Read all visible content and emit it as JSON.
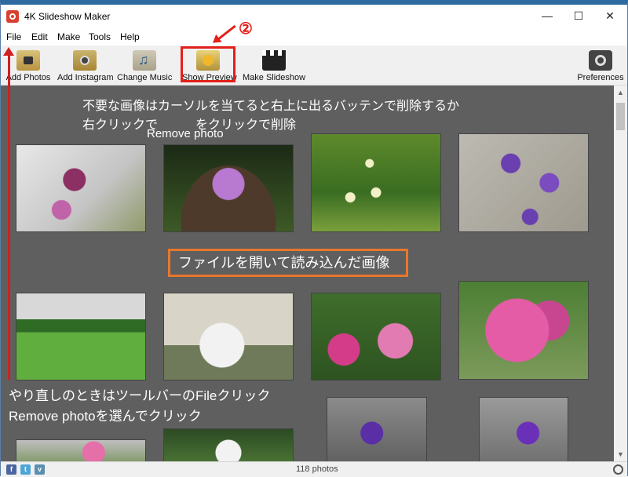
{
  "window": {
    "title": "4K Slideshow Maker"
  },
  "menu": [
    "File",
    "Edit",
    "Make",
    "Tools",
    "Help"
  ],
  "toolbar": {
    "add_photos": "Add Photos",
    "add_instagram": "Add Instagram",
    "change_music": "Change Music",
    "show_preview": "Show Preview",
    "make_slideshow": "Make Slideshow",
    "preferences": "Preferences"
  },
  "annotations": {
    "step_marker": "②",
    "delete_tip_line1": "不要な画像はカーソルを当てると右上に出るバッテンで削除するか",
    "delete_tip_line2": "右クリックで　　　をクリックで削除",
    "remove_photo": "Remove photo",
    "loaded_images": "ファイルを開いて読み込んだ画像",
    "redo_tip_line1": "やり直しのときはツールバーのFileクリック",
    "redo_tip_line2": "Remove photoを選んでクリック"
  },
  "status": {
    "photo_count": "118 photos"
  },
  "social": {
    "facebook": "f",
    "twitter": "t",
    "vimeo": "v"
  },
  "colors": {
    "annotation_red": "#e3201b",
    "annotation_orange": "#e9772c",
    "gallery_bg": "#5f5f5f"
  }
}
